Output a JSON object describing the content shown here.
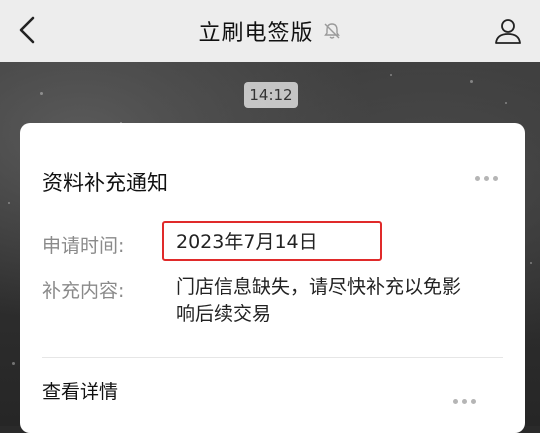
{
  "header": {
    "title": "立刷电签版",
    "back_icon": "chevron-left-icon",
    "mute_icon": "bell-muted-icon",
    "profile_icon": "user-icon"
  },
  "chat": {
    "timestamp": "14:12"
  },
  "card": {
    "title": "资料补充通知",
    "rows": [
      {
        "label": "申请时间:",
        "value": "2023年7月14日",
        "highlighted": true
      },
      {
        "label": "补充内容:",
        "value_lines": [
          "门店信息缺失，请尽快补充以免影",
          "响后续交易"
        ]
      }
    ],
    "details_link": "查看详情",
    "highlight_color": "#e02a2a"
  }
}
